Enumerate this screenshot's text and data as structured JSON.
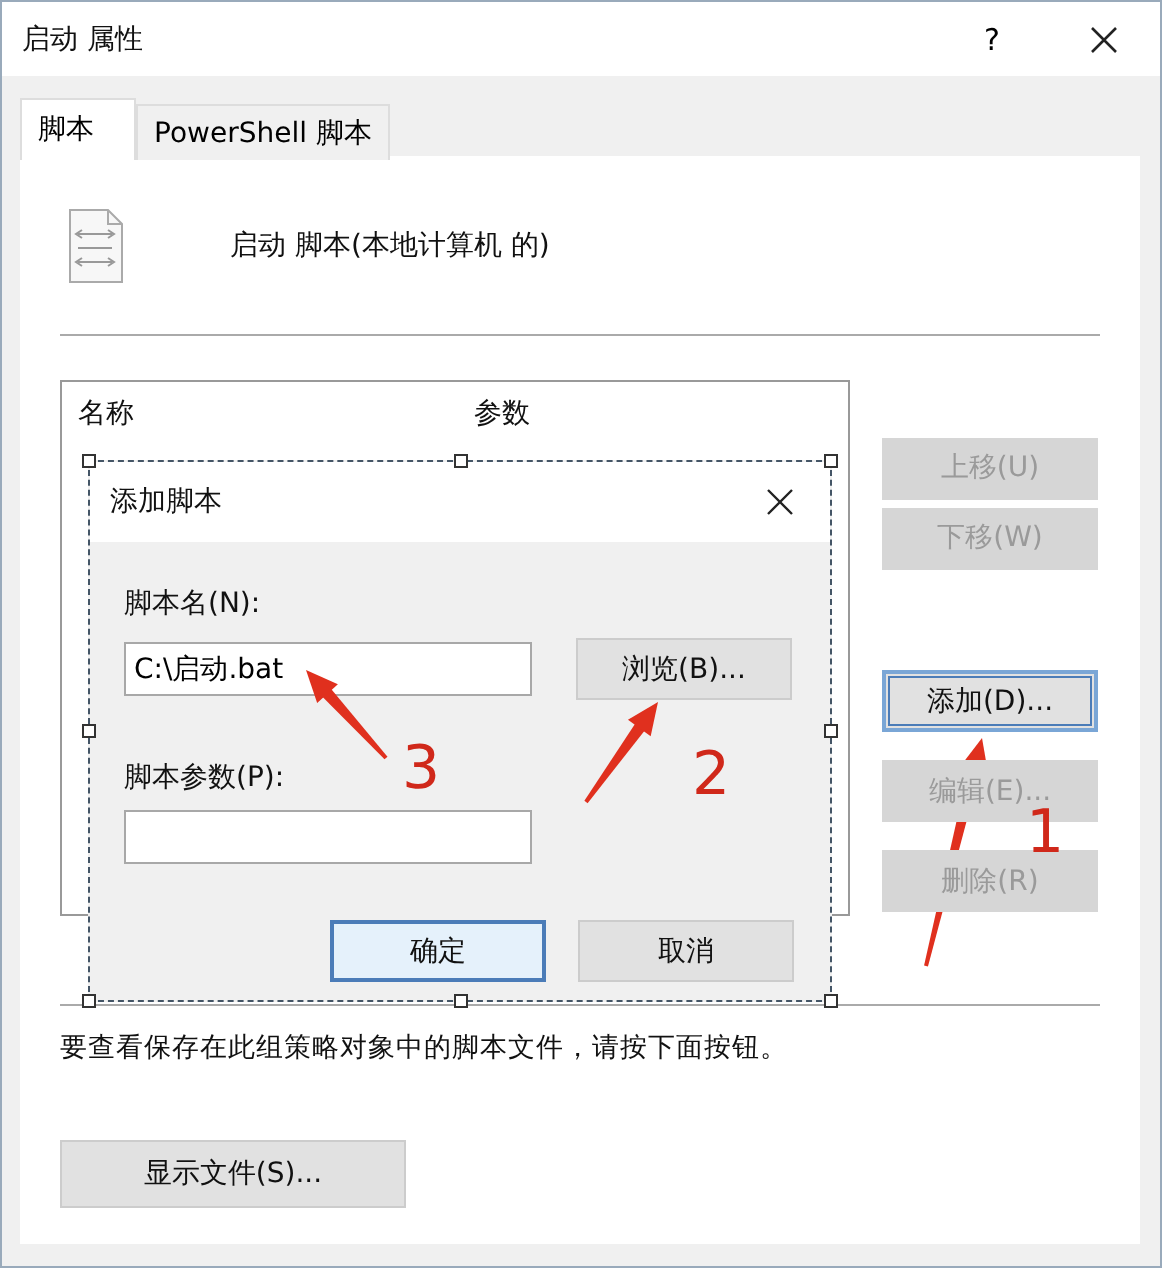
{
  "window": {
    "title": "启动 属性",
    "help": "?"
  },
  "tabs": [
    {
      "label": "脚本",
      "selected": true
    },
    {
      "label": "PowerShell 脚本",
      "selected": false
    }
  ],
  "heading": "启动 脚本(本地计算机 的)",
  "list": {
    "columns": [
      "名称",
      "参数"
    ]
  },
  "side_buttons": [
    {
      "label": "上移(U)",
      "disabled": true,
      "default": false
    },
    {
      "label": "下移(W)",
      "disabled": true,
      "default": false
    },
    {
      "label": "添加(D)...",
      "disabled": false,
      "default": true
    },
    {
      "label": "编辑(E)...",
      "disabled": true,
      "default": false
    },
    {
      "label": "删除(R)",
      "disabled": true,
      "default": false
    }
  ],
  "note": "要查看保存在此组策略对象中的脚本文件，请按下面按钮。",
  "show_files_button": "显示文件(S)...",
  "add_dialog": {
    "title": "添加脚本",
    "name_label": "脚本名(N):",
    "name_value": "C:\\启动.bat",
    "browse_button": "浏览(B)...",
    "params_label": "脚本参数(P):",
    "buttons": [
      {
        "label": "确定",
        "default": true
      },
      {
        "label": "取消",
        "default": false
      }
    ]
  },
  "annotations": [
    {
      "label": "1"
    },
    {
      "label": "2"
    },
    {
      "label": "3"
    }
  ]
}
